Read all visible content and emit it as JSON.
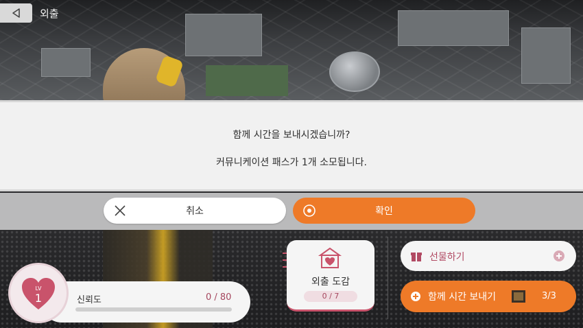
{
  "header": {
    "title": "외출"
  },
  "dialog": {
    "question": "함께 시간을 보내시겠습니까?",
    "cost_notice": "커뮤니케이션 패스가 1개 소모됩니다.",
    "cancel_label": "취소",
    "confirm_label": "확인"
  },
  "trust": {
    "lv_label": "LV",
    "level": "1",
    "label": "신뢰도",
    "value": "0 / 80",
    "progress": 0
  },
  "album": {
    "label": "외출 도감",
    "count": "0 / 7"
  },
  "actions": {
    "gift_label": "선물하기",
    "spend_time_label": "함께 시간 보내기",
    "spend_time_count": "3/3"
  },
  "colors": {
    "accent": "#ee7a28",
    "trust": "#c9536b",
    "dialog_bg": "#f1f1f1"
  },
  "icons": [
    "back-icon",
    "close-x-icon",
    "target-icon",
    "heart-icon",
    "tent-heart-icon",
    "gift-icon",
    "plus-circle-icon",
    "pass-item-icon"
  ]
}
